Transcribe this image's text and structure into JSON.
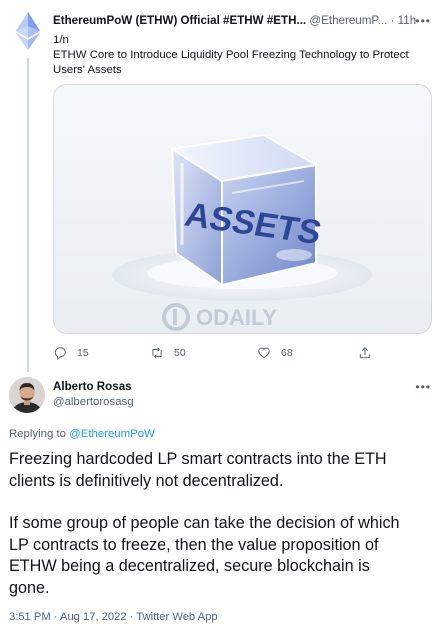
{
  "parent_tweet": {
    "author_name": "EthereumPoW (ETHW) Official #ETHW #ETH...",
    "author_handle": "@EthereumP...",
    "separator": "·",
    "time_ago": "11h",
    "more_label": "•••",
    "text_lines": [
      "1/n",
      "ETHW Core to Introduce Liquidity Pool Freezing Technology to Protect\nUsers' Assets"
    ],
    "media": {
      "cube_text": "ASSETS",
      "watermark_text": "ODAILY"
    },
    "actions": {
      "replies": "15",
      "retweets": "50",
      "likes": "68"
    }
  },
  "main_tweet": {
    "author_name": "Alberto Rosas",
    "author_handle": "@albertorosasg",
    "more_label": "•••",
    "replying_prefix": "Replying to",
    "replying_to": "@EthereumPoW",
    "paragraphs": [
      "Freezing hardcoded LP smart contracts into the ETH\nclients is definitively not decentralized.",
      "If some group of people can take the decision of which\nLP contracts to freeze, then the value proposition of\nETHW being a decentralized, secure blockchain is\ngone."
    ],
    "meta": "3:51 PM · Aug 17, 2022 · Twitter Web App"
  },
  "colors": {
    "link": "#1d9bf0",
    "secondary_text": "#536471",
    "primary_text": "#0f1419",
    "border": "#cfd9de"
  },
  "icons": [
    "ethereum-logo-icon",
    "more-icon",
    "reply-icon",
    "retweet-icon",
    "like-icon",
    "share-icon"
  ]
}
